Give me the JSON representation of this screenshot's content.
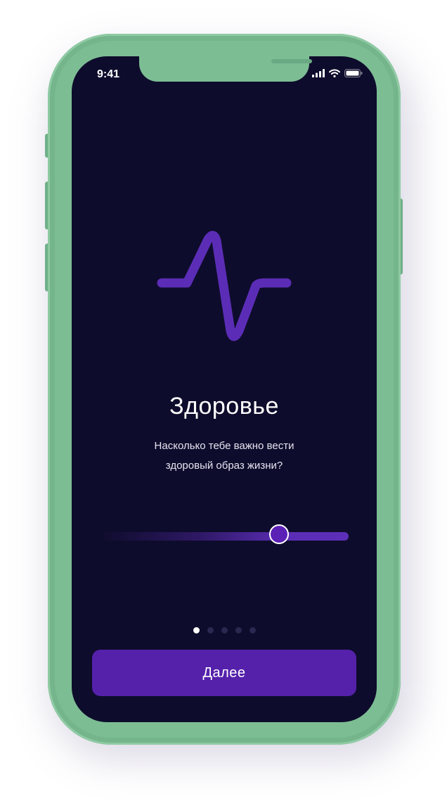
{
  "status_bar": {
    "time": "9:41",
    "icons": [
      "signal-icon",
      "wifi-icon",
      "battery-icon"
    ]
  },
  "onboarding": {
    "icon": "pulse-icon",
    "title": "Здоровье",
    "subtitle_line1": "Насколько тебе важно вести",
    "subtitle_line2": "здоровый образ жизни?",
    "slider_value": 0.72,
    "pager": {
      "total": 5,
      "current": 1
    },
    "next_label": "Далее"
  },
  "colors": {
    "background": "#0e0c2c",
    "accent": "#5521ab",
    "icon_stroke": "#5b2db6",
    "device": "#7dbd94"
  }
}
